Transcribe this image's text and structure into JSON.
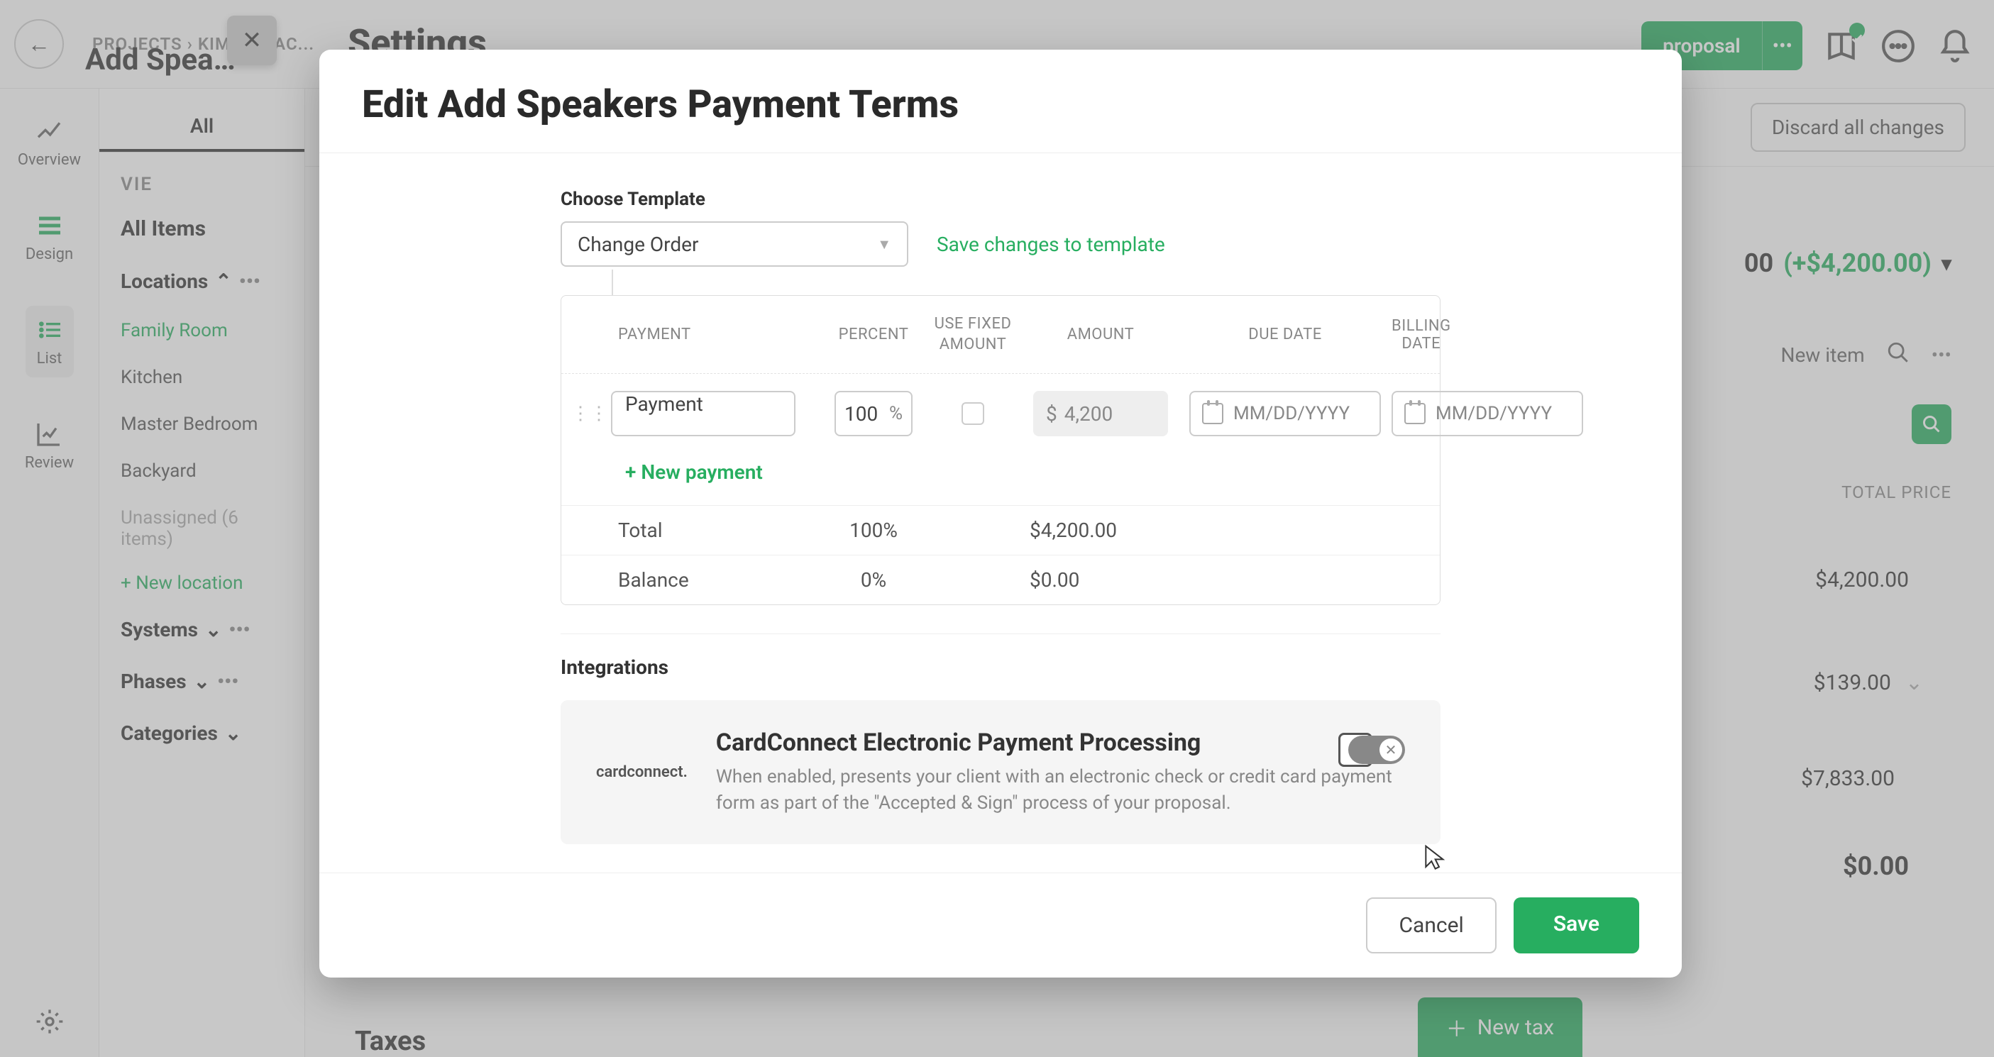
{
  "bg": {
    "breadcrumb": "PROJECTS  ›  KIM...   BEAC...",
    "page_title": "Add Spea…",
    "proposal_btn": "proposal",
    "discard": "Discard all changes",
    "sidenav": {
      "overview": "Overview",
      "design": "Design",
      "list": "List",
      "review": "Review"
    },
    "tabs": {
      "all": "All"
    },
    "view_label": "VIE",
    "all_items": "All Items",
    "locations_head": "Locations",
    "locations": [
      "Family Room",
      "Kitchen",
      "Master Bedroom",
      "Backyard",
      "Unassigned (6 items)"
    ],
    "add_location": "+ New location",
    "systems_head": "Systems",
    "phases_head": "Phases",
    "categories_head": "Categories",
    "total_amount": "00",
    "total_delta": "(+$4,200.00)",
    "new_item": "New item",
    "price_header": "TOTAL PRICE",
    "prices": [
      "$4,200.00",
      "$139.00",
      "$7,833.00",
      "$0.00"
    ],
    "settings_title": "Settings",
    "taxes": "Taxes",
    "new_tax": "New tax"
  },
  "modal": {
    "title": "Edit Add Speakers Payment Terms",
    "choose_template_label": "Choose Template",
    "template_value": "Change Order",
    "save_template_link": "Save changes to template",
    "columns": {
      "payment": "PAYMENT",
      "percent": "PERCENT",
      "use_fixed": "USE FIXED AMOUNT",
      "amount": "AMOUNT",
      "due_date": "DUE DATE",
      "billing_date": "BILLING DATE"
    },
    "row": {
      "name": "Payment",
      "percent": "100",
      "amount_currency": "$",
      "amount_value": "4,200",
      "date_placeholder": "MM/DD/YYYY"
    },
    "new_payment": "+ New payment",
    "totals": {
      "total_label": "Total",
      "total_percent": "100%",
      "total_amount": "$4,200.00",
      "balance_label": "Balance",
      "balance_percent": "0%",
      "balance_amount": "$0.00"
    },
    "integrations_label": "Integrations",
    "integration": {
      "logo_text": "cardconnect.",
      "title": "CardConnect Electronic Payment Processing",
      "desc": "When enabled, presents your client with an electronic check or credit card payment form as part of the \"Accepted & Sign\" process of your proposal."
    },
    "cancel": "Cancel",
    "save": "Save"
  }
}
